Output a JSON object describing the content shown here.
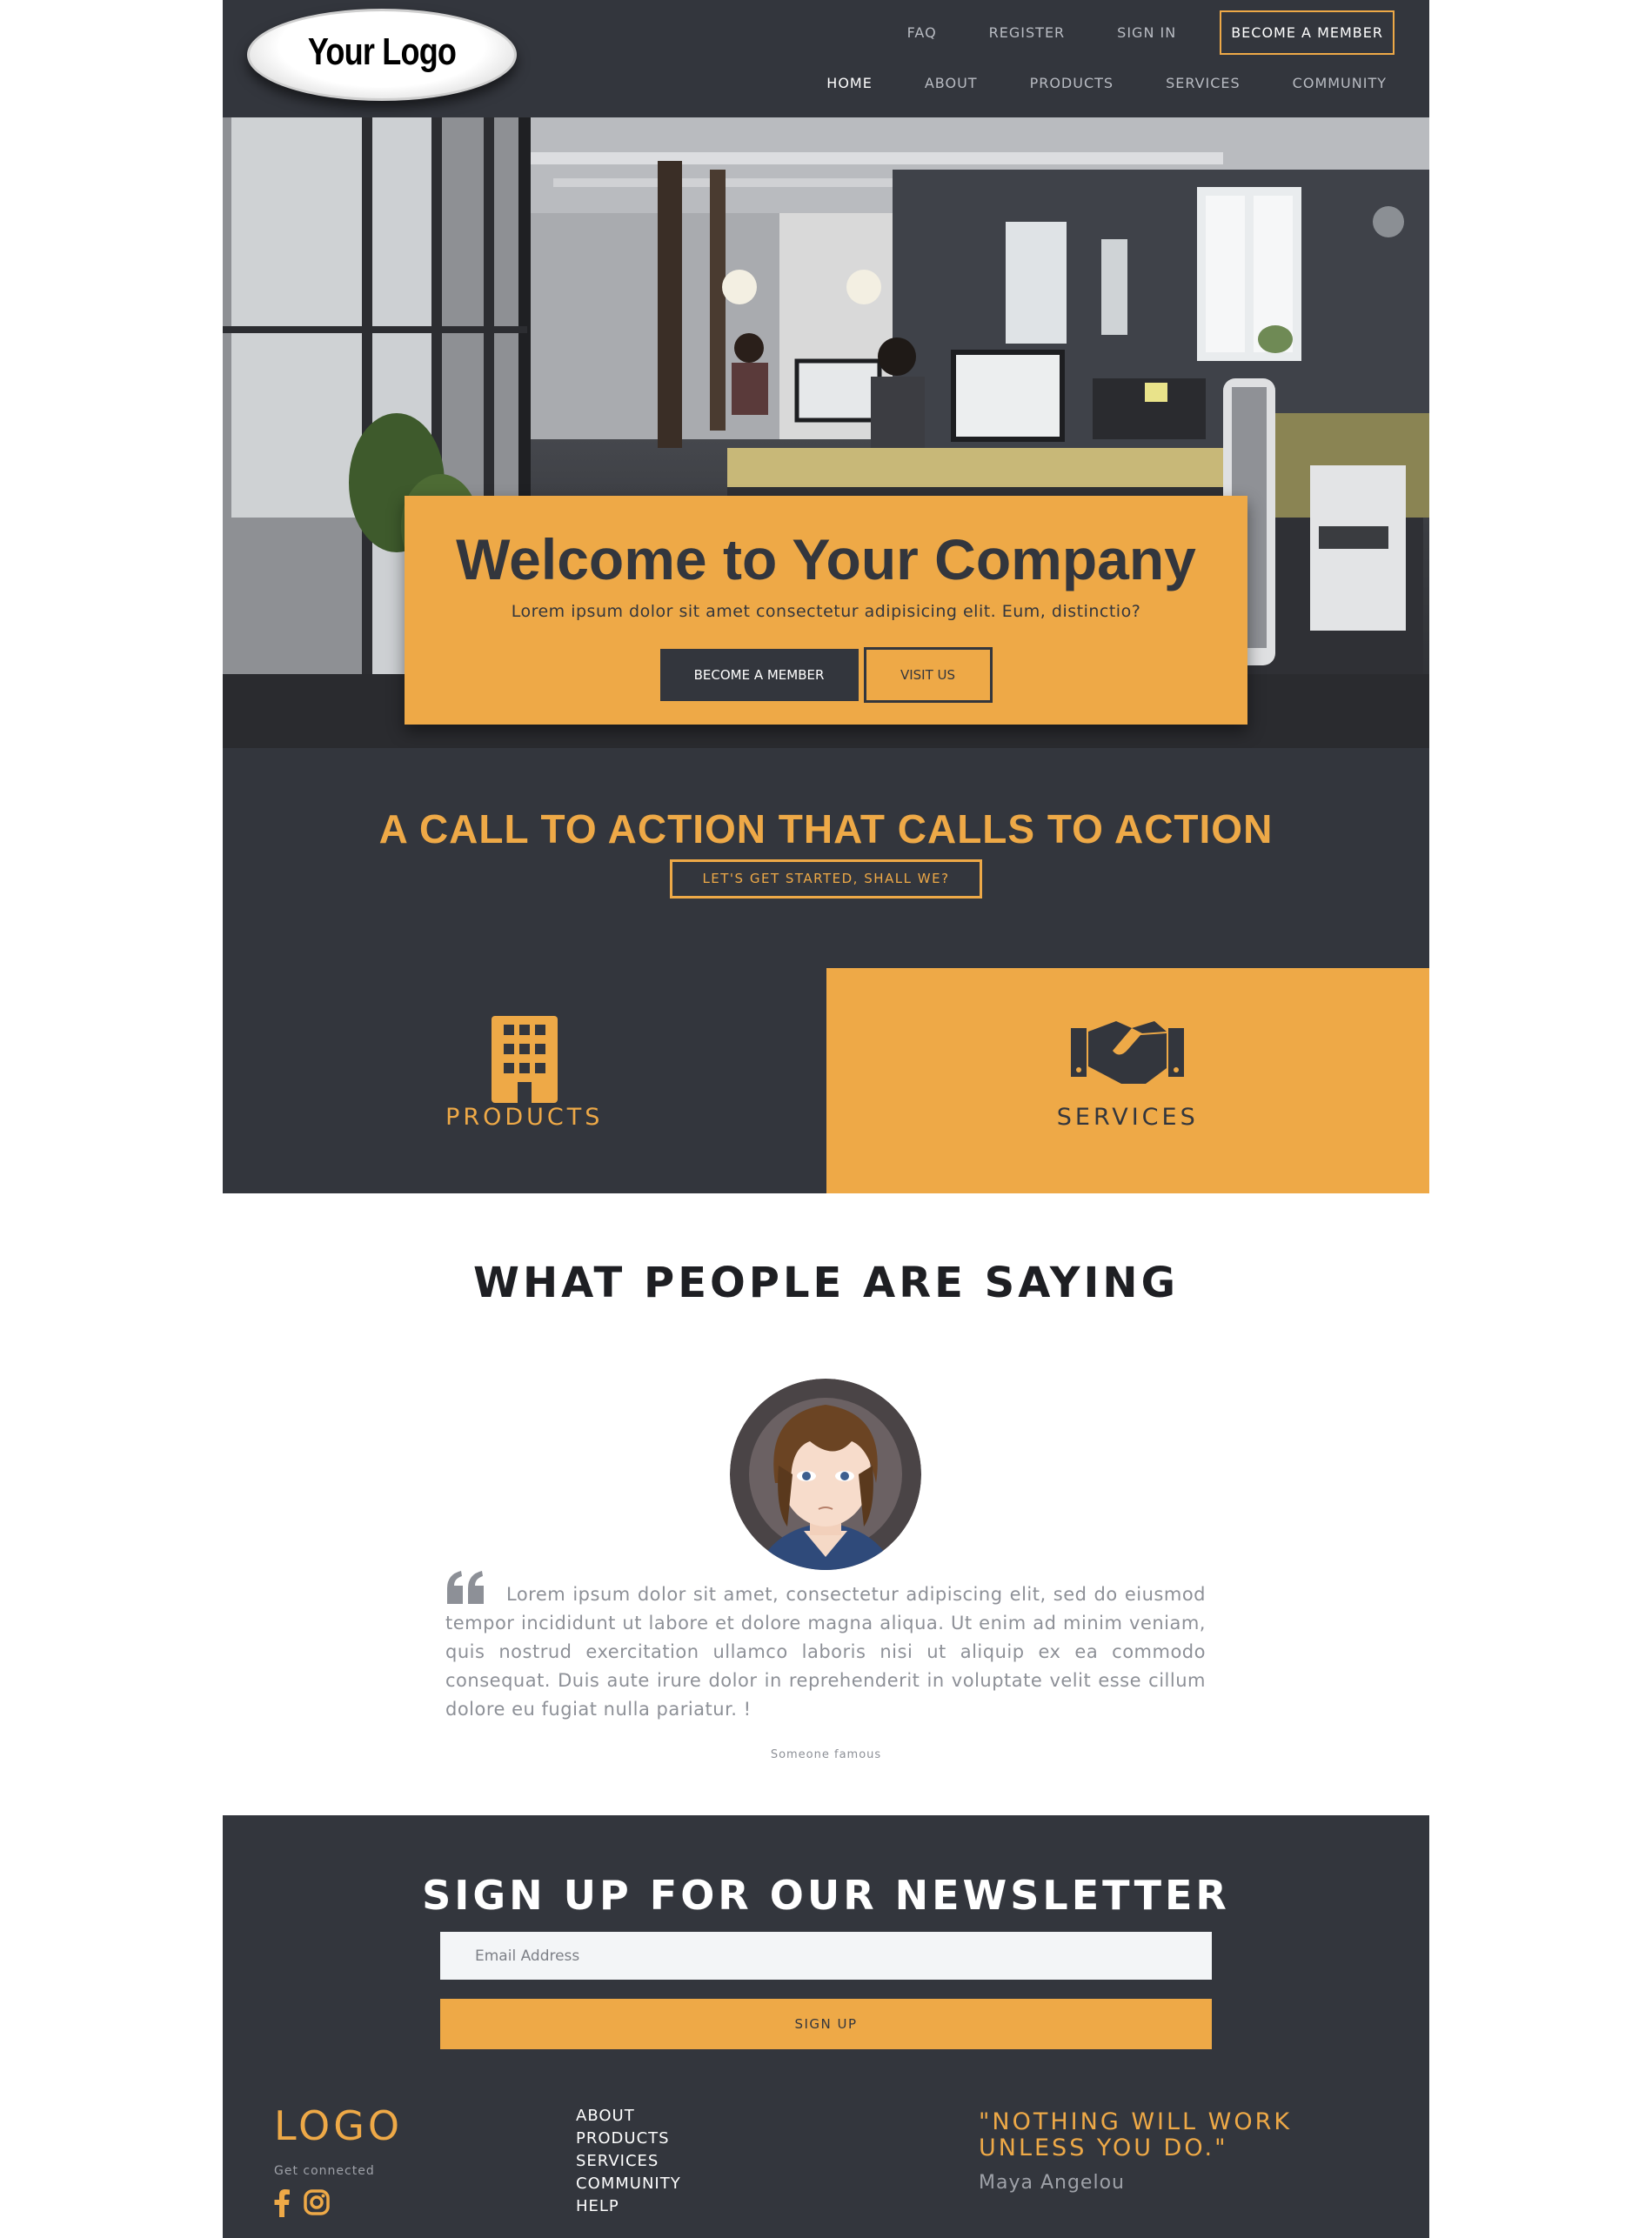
{
  "header": {
    "logo_text": "Your Logo",
    "utility_nav": [
      "FAQ",
      "REGISTER",
      "SIGN IN"
    ],
    "member_button": "BECOME A MEMBER",
    "main_nav": [
      {
        "label": "HOME",
        "active": true
      },
      {
        "label": "ABOUT",
        "active": false
      },
      {
        "label": "PRODUCTS",
        "active": false
      },
      {
        "label": "SERVICES",
        "active": false
      },
      {
        "label": "COMMUNITY",
        "active": false
      }
    ]
  },
  "hero": {
    "title": "Welcome to Your Company",
    "subtitle": "Lorem ipsum dolor sit amet consectetur adipisicing elit. Eum, distinctio?",
    "primary_button": "BECOME A MEMBER",
    "secondary_button": "VISIT US"
  },
  "cta": {
    "title": "A CALL TO ACTION THAT CALLS TO ACTION",
    "button": "LET'S GET STARTED, SHALL WE?"
  },
  "tiles": {
    "products": {
      "label": "PRODUCTS",
      "icon": "building-icon"
    },
    "services": {
      "label": "SERVICES",
      "icon": "handshake-icon"
    }
  },
  "testimonial": {
    "title": "WHAT PEOPLE ARE SAYING",
    "quote": "Lorem ipsum dolor sit amet, consectetur adipiscing elit, sed do eiusmod tempor incididunt ut labore et dolore magna aliqua. Ut enim ad minim veniam, quis nostrud exercitation ullamco laboris nisi ut aliquip ex ea commodo consequat. Duis aute irure dolor in reprehenderit in voluptate velit esse cillum dolore eu fugiat nulla pariatur. !",
    "author": "Someone famous"
  },
  "newsletter": {
    "title": "SIGN UP FOR OUR NEWSLETTER",
    "email_placeholder": "Email Address",
    "email_value": "",
    "button": "SIGN UP"
  },
  "footer": {
    "logo": "LOGO",
    "tagline": "Get connected",
    "social_icons": [
      "facebook-icon",
      "instagram-icon"
    ],
    "links": [
      "ABOUT",
      "PRODUCTS",
      "SERVICES",
      "COMMUNITY",
      "HELP"
    ],
    "quote": "\"NOTHING WILL WORK UNLESS YOU DO.\"",
    "quote_author": "Maya Angelou"
  },
  "colors": {
    "dark": "#33363d",
    "accent": "#eea947",
    "white": "#ffffff",
    "muted": "#8d9097"
  }
}
